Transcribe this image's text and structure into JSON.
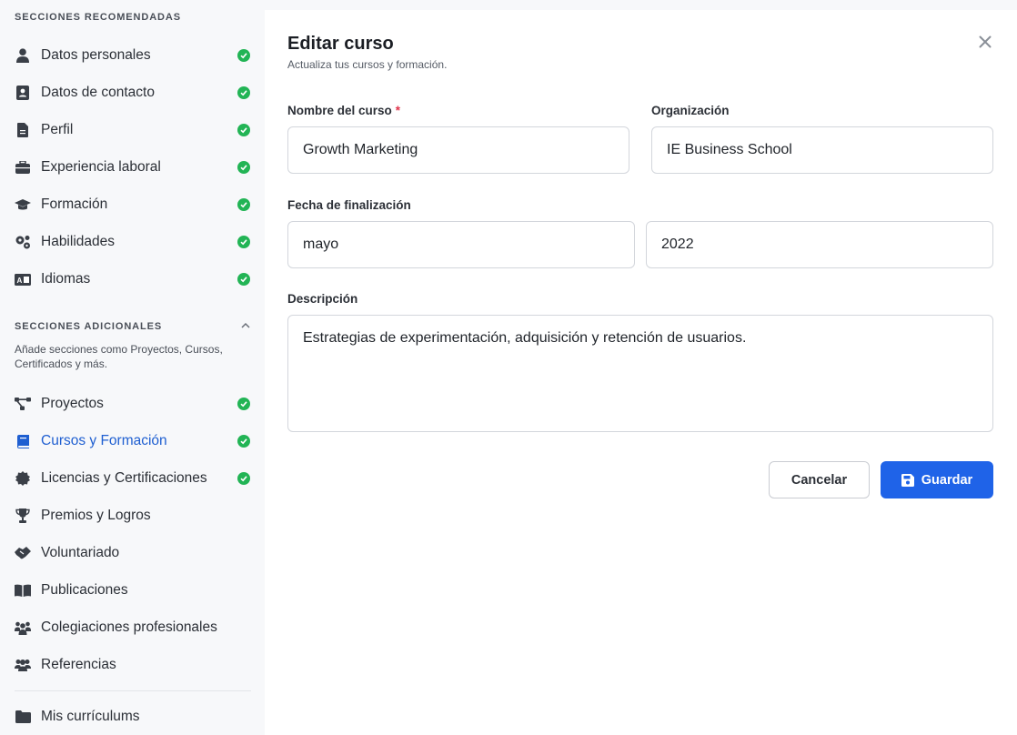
{
  "sidebar": {
    "recommended_title": "SECCIONES RECOMENDADAS",
    "recommended": [
      {
        "label": "Datos personales",
        "icon": "user-icon",
        "done": true
      },
      {
        "label": "Datos de contacto",
        "icon": "contact-card-icon",
        "done": true
      },
      {
        "label": "Perfil",
        "icon": "document-icon",
        "done": true
      },
      {
        "label": "Experiencia laboral",
        "icon": "briefcase-icon",
        "done": true
      },
      {
        "label": "Formación",
        "icon": "graduation-cap-icon",
        "done": true
      },
      {
        "label": "Habilidades",
        "icon": "gears-icon",
        "done": true
      },
      {
        "label": "Idiomas",
        "icon": "language-icon",
        "done": true
      }
    ],
    "additional_title": "SECCIONES ADICIONALES",
    "additional_desc": "Añade secciones como Proyectos, Cursos, Certificados y más.",
    "additional": [
      {
        "label": "Proyectos",
        "icon": "project-diagram-icon",
        "done": true
      },
      {
        "label": "Cursos y Formación",
        "icon": "book-icon",
        "done": true,
        "active": true
      },
      {
        "label": "Licencias y Certificaciones",
        "icon": "certificate-icon",
        "done": true
      },
      {
        "label": "Premios y Logros",
        "icon": "trophy-icon",
        "done": false
      },
      {
        "label": "Voluntariado",
        "icon": "handshake-icon",
        "done": false
      },
      {
        "label": "Publicaciones",
        "icon": "open-book-icon",
        "done": false
      },
      {
        "label": "Colegiaciones profesionales",
        "icon": "people-group-icon",
        "done": false
      },
      {
        "label": "Referencias",
        "icon": "users-icon",
        "done": false
      }
    ],
    "footer_item": {
      "label": "Mis currículums",
      "icon": "folder-icon"
    }
  },
  "form": {
    "title": "Editar curso",
    "subtitle": "Actualiza tus cursos y formación.",
    "course_name_label": "Nombre del curso",
    "required_mark": "*",
    "course_name_value": "Growth Marketing",
    "organization_label": "Organización",
    "organization_value": "IE Business School",
    "end_date_label": "Fecha de finalización",
    "end_month_value": "mayo",
    "end_year_value": "2022",
    "description_label": "Descripción",
    "description_value": "Estrategias de experimentación, adquisición y retención de usuarios.",
    "cancel_label": "Cancelar",
    "save_label": "Guardar"
  },
  "colors": {
    "accent": "#1f63e8",
    "active_link": "#1f5fd1",
    "check_green": "#22b455",
    "required_red": "#e0324a"
  }
}
